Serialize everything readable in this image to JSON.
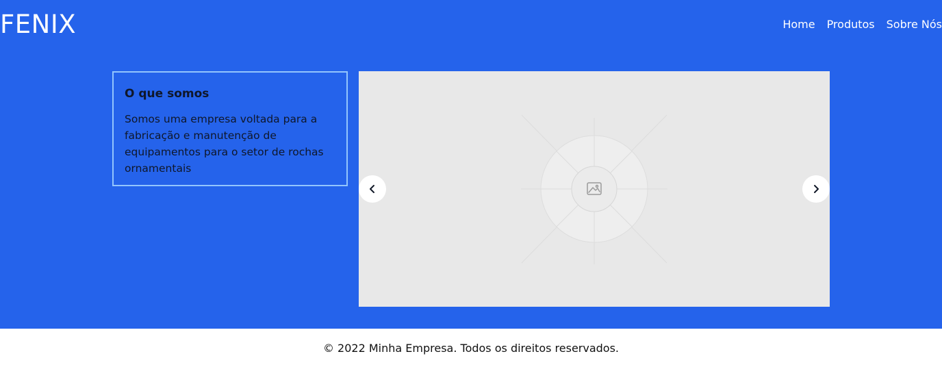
{
  "header": {
    "logo": "FENIX",
    "nav": [
      {
        "label": "Home"
      },
      {
        "label": "Produtos"
      },
      {
        "label": "Sobre Nós"
      }
    ]
  },
  "about": {
    "title": "O que somos",
    "text": "Somos uma empresa voltada para a fabricação e manutenção de equipamentos para o setor de rochas ornamentais"
  },
  "carousel": {
    "prev_icon": "chevron-left-icon",
    "next_icon": "chevron-right-icon",
    "image_icon": "image-placeholder-icon"
  },
  "footer": {
    "text": "© 2022 Minha Empresa. Todos os direitos reservados."
  },
  "colors": {
    "primary": "#2563eb",
    "card_border": "#93c5fd",
    "carousel_bg": "#e8e8e8",
    "footer_bg": "#ffffff"
  }
}
